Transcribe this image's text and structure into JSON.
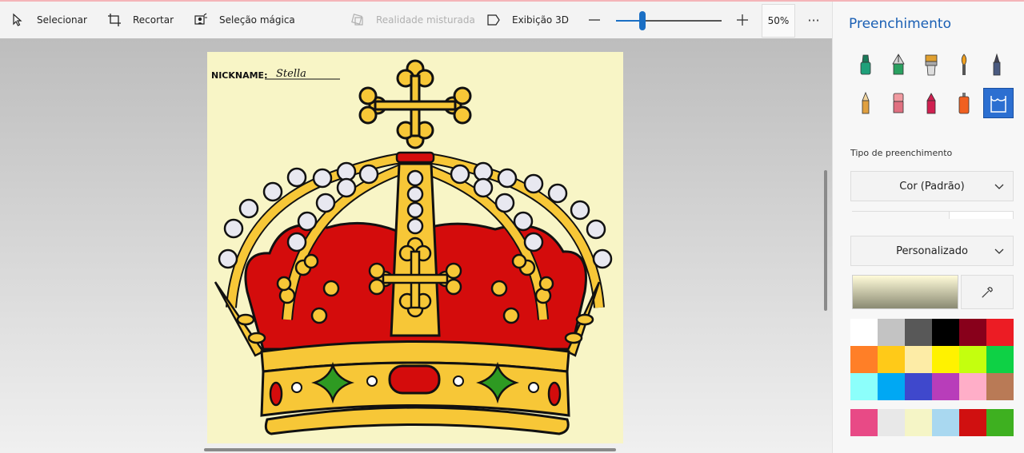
{
  "toolbar": {
    "select_label": "Selecionar",
    "crop_label": "Recortar",
    "magic_select_label": "Seleção mágica",
    "mixed_reality_label": "Realidade misturada",
    "view3d_label": "Exibição 3D",
    "zoom_percent": "50%",
    "zoom_fraction": 0.25,
    "more_label": "···"
  },
  "canvas": {
    "nickname_label": "NICKNAME:",
    "nickname_value": "Stella"
  },
  "panel": {
    "title": "Preenchimento",
    "fill_type_label": "Tipo de preenchimento",
    "fill_type_value": "Cor (Padrão)",
    "color_mode_value": "Personalizado"
  },
  "brushes": [
    {
      "name": "marker-icon",
      "color": "#1a9a6a"
    },
    {
      "name": "calligraphy-pen-icon",
      "color": "#2aa060"
    },
    {
      "name": "oil-brush-icon",
      "color": "#e0a030"
    },
    {
      "name": "watercolor-brush-icon",
      "color": "#e89020"
    },
    {
      "name": "pixel-pen-icon",
      "color": "#4a5a80"
    },
    {
      "name": "pencil-icon",
      "color": "#e0a040"
    },
    {
      "name": "eraser-icon",
      "color": "#e07080"
    },
    {
      "name": "crayon-icon",
      "color": "#d02050"
    },
    {
      "name": "spray-can-icon",
      "color": "#f06020"
    },
    {
      "name": "fill-bucket-icon",
      "color": "#ffffff"
    }
  ],
  "colors": {
    "accent": "#1a6fc4",
    "palette": [
      "#ffffff",
      "#c3c3c3",
      "#585858",
      "#000000",
      "#88001b",
      "#ec1c24",
      "#ff7f27",
      "#ffca18",
      "#fdeca6",
      "#fff200",
      "#c4ff0e",
      "#0ed145",
      "#8cfffb",
      "#00a8f3",
      "#3f48cc",
      "#b83dba",
      "#ffaec8",
      "#b97a56"
    ],
    "custom": [
      "#e84a86",
      "#e8e8e8",
      "#f5f5c6",
      "#a9d8f0",
      "#d01010",
      "#3eb020"
    ]
  }
}
